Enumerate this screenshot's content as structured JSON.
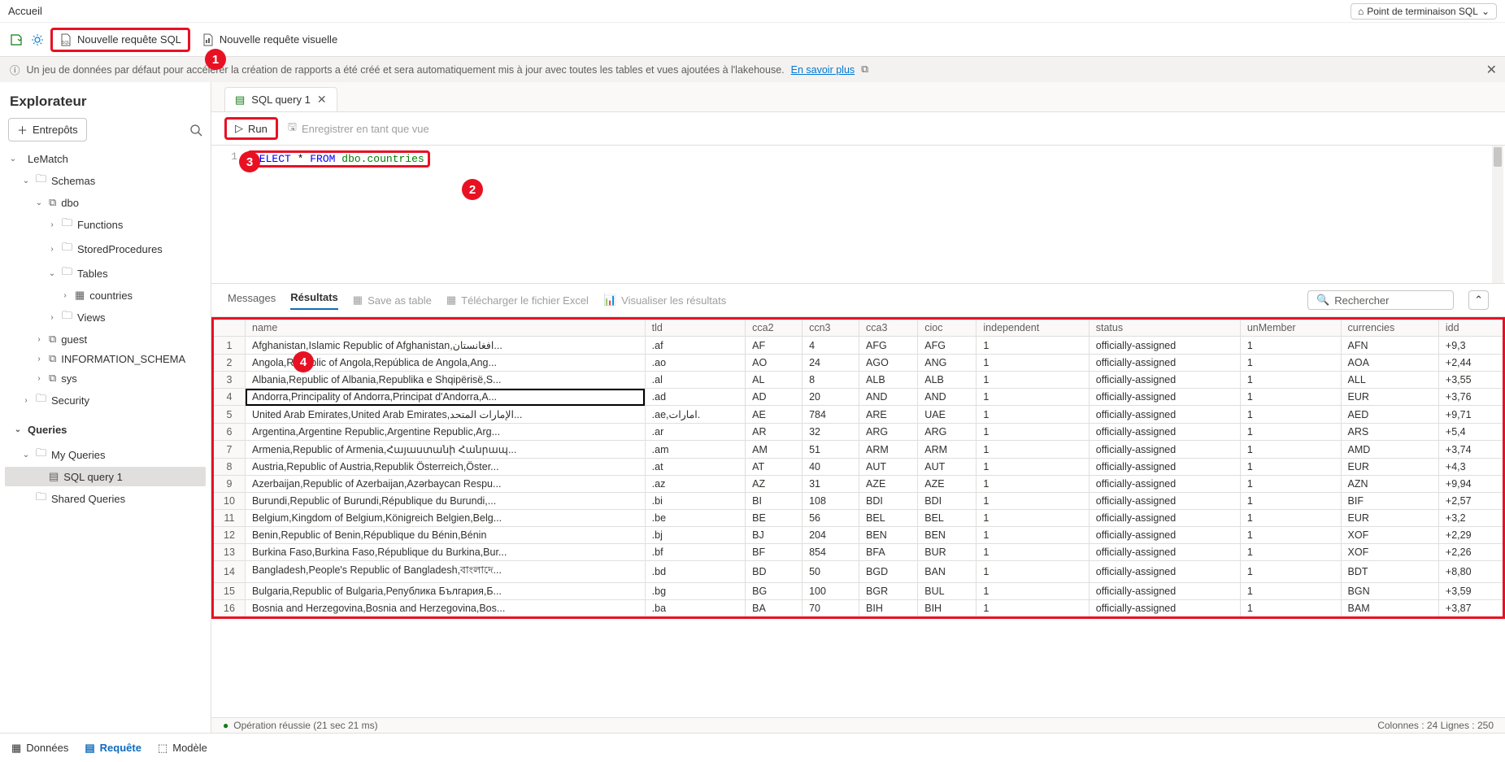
{
  "topbar": {
    "home": "Accueil",
    "endpoint": "Point de terminaison SQL"
  },
  "toolbar": {
    "new_sql": "Nouvelle requête SQL",
    "new_visual": "Nouvelle requête visuelle"
  },
  "banner": {
    "text": "Un jeu de données par défaut pour accélérer la création de rapports a été créé et sera automatiquement mis à jour avec toutes les tables et vues ajoutées à l'lakehouse.",
    "link": "En savoir plus"
  },
  "explorer": {
    "title": "Explorateur",
    "entrepots": "Entrepôts",
    "tree": [
      {
        "label": "LeMatch",
        "indent": 0,
        "chev": "v",
        "icon": ""
      },
      {
        "label": "Schemas",
        "indent": 1,
        "chev": "v",
        "icon": "folder"
      },
      {
        "label": "dbo",
        "indent": 2,
        "chev": "v",
        "icon": "schema"
      },
      {
        "label": "Functions",
        "indent": 3,
        "chev": ">",
        "icon": "folder"
      },
      {
        "label": "StoredProcedures",
        "indent": 3,
        "chev": ">",
        "icon": "folder"
      },
      {
        "label": "Tables",
        "indent": 3,
        "chev": "v",
        "icon": "folder"
      },
      {
        "label": "countries",
        "indent": 4,
        "chev": ">",
        "icon": "table"
      },
      {
        "label": "Views",
        "indent": 3,
        "chev": ">",
        "icon": "folder"
      },
      {
        "label": "guest",
        "indent": 2,
        "chev": ">",
        "icon": "schema"
      },
      {
        "label": "INFORMATION_SCHEMA",
        "indent": 2,
        "chev": ">",
        "icon": "schema"
      },
      {
        "label": "sys",
        "indent": 2,
        "chev": ">",
        "icon": "schema"
      },
      {
        "label": "Security",
        "indent": 1,
        "chev": ">",
        "icon": "folder"
      }
    ],
    "queries_label": "Queries",
    "queries": [
      {
        "label": "My Queries",
        "indent": 1,
        "chev": "v",
        "icon": "folder"
      },
      {
        "label": "SQL query 1",
        "indent": 2,
        "chev": "",
        "icon": "sql",
        "selected": true
      },
      {
        "label": "Shared Queries",
        "indent": 1,
        "chev": "",
        "icon": "folder"
      }
    ]
  },
  "tab": {
    "name": "SQL query 1"
  },
  "editor": {
    "run": "Run",
    "save_view": "Enregistrer en tant que vue",
    "line": "1",
    "kw1": "SELECT",
    "star": "*",
    "kw2": "FROM",
    "table": "dbo.countries"
  },
  "results_toolbar": {
    "messages": "Messages",
    "results": "Résultats",
    "save_table": "Save as table",
    "download_excel": "Télécharger le fichier Excel",
    "visualize": "Visualiser les résultats",
    "search": "Rechercher"
  },
  "grid": {
    "headers": [
      "",
      "name",
      "tld",
      "cca2",
      "ccn3",
      "cca3",
      "cioc",
      "independent",
      "status",
      "unMember",
      "currencies",
      "idd"
    ],
    "rows": [
      [
        "1",
        "Afghanistan,Islamic Republic of Afghanistan,افغانستان...",
        ".af",
        "AF",
        "4",
        "AFG",
        "AFG",
        "1",
        "officially-assigned",
        "1",
        "AFN",
        "+9,3"
      ],
      [
        "2",
        "Angola,Republic of Angola,República de Angola,Ang...",
        ".ao",
        "AO",
        "24",
        "AGO",
        "ANG",
        "1",
        "officially-assigned",
        "1",
        "AOA",
        "+2,44"
      ],
      [
        "3",
        "Albania,Republic of Albania,Republika e Shqipërisë,S...",
        ".al",
        "AL",
        "8",
        "ALB",
        "ALB",
        "1",
        "officially-assigned",
        "1",
        "ALL",
        "+3,55"
      ],
      [
        "4",
        "Andorra,Principality of Andorra,Principat d'Andorra,A...",
        ".ad",
        "AD",
        "20",
        "AND",
        "AND",
        "1",
        "officially-assigned",
        "1",
        "EUR",
        "+3,76"
      ],
      [
        "5",
        "United Arab Emirates,United Arab Emirates,الإمارات المتحد...",
        ".ae,امارات.",
        "AE",
        "784",
        "ARE",
        "UAE",
        "1",
        "officially-assigned",
        "1",
        "AED",
        "+9,71"
      ],
      [
        "6",
        "Argentina,Argentine Republic,Argentine Republic,Arg...",
        ".ar",
        "AR",
        "32",
        "ARG",
        "ARG",
        "1",
        "officially-assigned",
        "1",
        "ARS",
        "+5,4"
      ],
      [
        "7",
        "Armenia,Republic of Armenia,Հայաստանի Հանրապ...",
        ".am",
        "AM",
        "51",
        "ARM",
        "ARM",
        "1",
        "officially-assigned",
        "1",
        "AMD",
        "+3,74"
      ],
      [
        "8",
        "Austria,Republic of Austria,Republik Österreich,Öster...",
        ".at",
        "AT",
        "40",
        "AUT",
        "AUT",
        "1",
        "officially-assigned",
        "1",
        "EUR",
        "+4,3"
      ],
      [
        "9",
        "Azerbaijan,Republic of Azerbaijan,Azərbaycan Respu...",
        ".az",
        "AZ",
        "31",
        "AZE",
        "AZE",
        "1",
        "officially-assigned",
        "1",
        "AZN",
        "+9,94"
      ],
      [
        "10",
        "Burundi,Republic of Burundi,République du Burundi,...",
        ".bi",
        "BI",
        "108",
        "BDI",
        "BDI",
        "1",
        "officially-assigned",
        "1",
        "BIF",
        "+2,57"
      ],
      [
        "11",
        "Belgium,Kingdom of Belgium,Königreich Belgien,Belg...",
        ".be",
        "BE",
        "56",
        "BEL",
        "BEL",
        "1",
        "officially-assigned",
        "1",
        "EUR",
        "+3,2"
      ],
      [
        "12",
        "Benin,Republic of Benin,République du Bénin,Bénin",
        ".bj",
        "BJ",
        "204",
        "BEN",
        "BEN",
        "1",
        "officially-assigned",
        "1",
        "XOF",
        "+2,29"
      ],
      [
        "13",
        "Burkina Faso,Burkina Faso,République du Burkina,Bur...",
        ".bf",
        "BF",
        "854",
        "BFA",
        "BUR",
        "1",
        "officially-assigned",
        "1",
        "XOF",
        "+2,26"
      ],
      [
        "14",
        "Bangladesh,People's Republic of Bangladesh,বাংলাদে...",
        ".bd",
        "BD",
        "50",
        "BGD",
        "BAN",
        "1",
        "officially-assigned",
        "1",
        "BDT",
        "+8,80"
      ],
      [
        "15",
        "Bulgaria,Republic of Bulgaria,Република България,Б...",
        ".bg",
        "BG",
        "100",
        "BGR",
        "BUL",
        "1",
        "officially-assigned",
        "1",
        "BGN",
        "+3,59"
      ],
      [
        "16",
        "Bosnia and Herzegovina,Bosnia and Herzegovina,Bos...",
        ".ba",
        "BA",
        "70",
        "BIH",
        "BIH",
        "1",
        "officially-assigned",
        "1",
        "BAM",
        "+3,87"
      ]
    ],
    "selected_row": 3
  },
  "status": {
    "msg": "Opération réussie (21 sec 21 ms)",
    "right": "Colonnes : 24  Lignes : 250"
  },
  "footer": {
    "data": "Données",
    "query": "Requête",
    "model": "Modèle"
  },
  "callouts": {
    "c1": "1",
    "c2": "2",
    "c3": "3",
    "c4": "4"
  }
}
